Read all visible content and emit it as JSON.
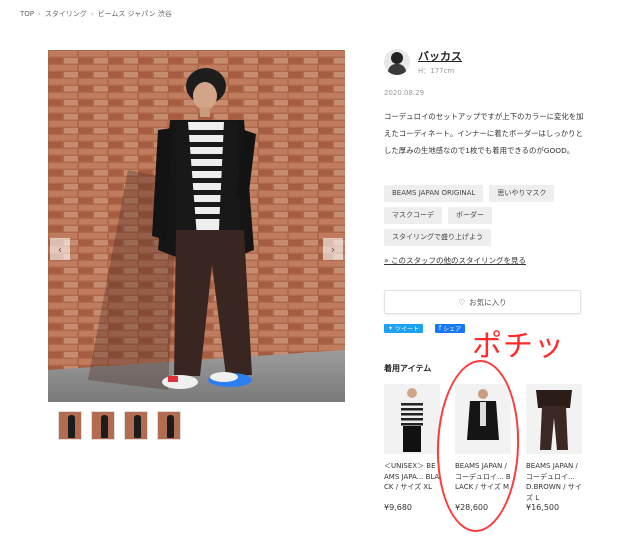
{
  "breadcrumb": [
    "TOP",
    "スタイリング",
    "ビームス ジャパン 渋谷"
  ],
  "staff": {
    "name": "バッカス",
    "height": "H：177cm"
  },
  "date": "2020.08.29",
  "description": "コーデュロイのセットアップですが上下のカラーに変化を加えたコーディネート。インナーに着たボーダーはしっかりとした厚みの生地感なので1枚でも着用できるのがGOOD。",
  "tags": [
    "BEAMS JAPAN ORIGINAL",
    "思いやりマスク",
    "マスクコーデ",
    "ボーダー",
    "スタイリングで盛り上げよう"
  ],
  "more_link": "» このスタッフの他のスタイリングを見る",
  "favorite_label": "お気に入り",
  "share": {
    "twitter": "ツイート",
    "facebook": "シェア"
  },
  "used_items_title": "着用アイテム",
  "items": [
    {
      "text": "＜UNISEX＞ BEAMS JAPA... BLACK / サイズ XL",
      "price": "¥9,680"
    },
    {
      "text": "BEAMS JAPAN / コーデュロイ... BLACK / サイズ M",
      "price": "¥28,600"
    },
    {
      "text": "BEAMS JAPAN / コーデュロイ... D.BROWN / サイズ L",
      "price": "¥16,500"
    }
  ],
  "annotation": "ポチッ",
  "colors": {
    "annotation": "#ff2a2a",
    "twitter": "#1da1f2",
    "facebook": "#1877f2"
  }
}
